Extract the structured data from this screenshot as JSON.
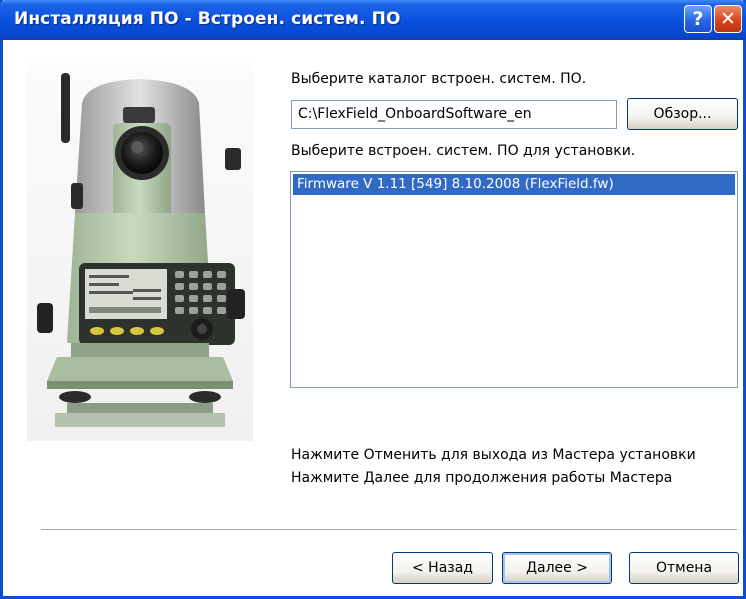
{
  "window": {
    "title": "Инсталляция ПО - Встроен. систем. ПО",
    "help_label": "?",
    "close_label": "✕"
  },
  "main": {
    "directory_label": "Выберите каталог встроен. систем. ПО.",
    "directory_value": "C:\\FlexField_OnboardSoftware_en",
    "browse_label": "Обзор...",
    "select_label": "Выберите встроен. систем. ПО для установки.",
    "firmware_items": [
      "Firmware V 1.11 [549] 8.10.2008 (FlexField.fw)"
    ],
    "hint_cancel": "Нажмите Отменить для выхода из Мастера установки",
    "hint_next": "Нажмите Далее для продолжения работы Мастера"
  },
  "buttons": {
    "back_label": "< Назад",
    "next_label": "Далее >",
    "cancel_label": "Отмена"
  },
  "colors": {
    "titlebar": "#0a52df",
    "selection": "#316ac5",
    "instrument_body": "#b9cdb0"
  },
  "icons": {
    "help": "help-icon",
    "close": "close-icon"
  }
}
